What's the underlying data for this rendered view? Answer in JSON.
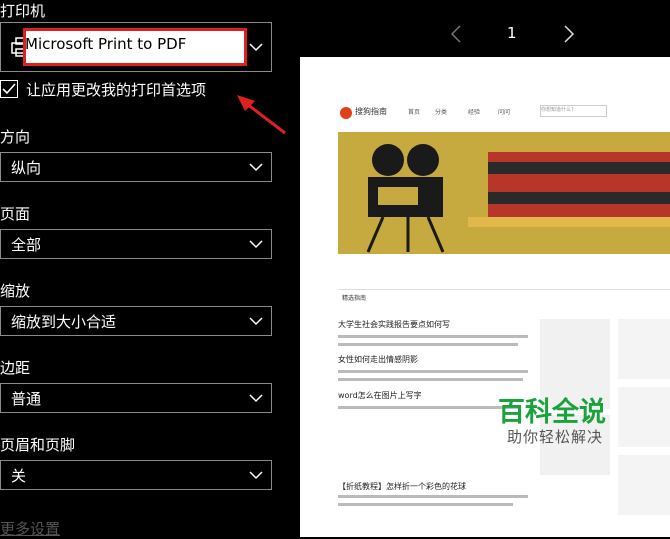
{
  "left": {
    "printer_label": "打印机",
    "printer_name": "Microsoft Print to PDF",
    "checkbox_label": "让应用更改我的打印首选项",
    "orientation": {
      "label": "方向",
      "value": "纵向"
    },
    "pages": {
      "label": "页面",
      "value": "全部"
    },
    "scale": {
      "label": "缩放",
      "value": "缩放到大小合适"
    },
    "margins": {
      "label": "边距",
      "value": "普通"
    },
    "header_footer": {
      "label": "页眉和页脚",
      "value": "关"
    },
    "more_settings": "更多设置"
  },
  "preview": {
    "page_number": "1",
    "site_logo": "搜狗指南",
    "nav": [
      "首页",
      "分类",
      "经验",
      "问问"
    ],
    "search_placeholder": "你想知道什么?",
    "tab": "精选指南",
    "articles": [
      {
        "title": "大学生社会实践报告要点如何写"
      },
      {
        "title": "女性如何走出情感阴影"
      },
      {
        "title": "word怎么在图片上写字"
      },
      {
        "title": "【折纸教程】怎样折一个彩色的花球"
      }
    ],
    "watermark_main": "百科全说",
    "watermark_sub": "助你轻松解决"
  },
  "colors": {
    "accent_red": "#e02020",
    "watermark_green": "#1aa33c"
  }
}
